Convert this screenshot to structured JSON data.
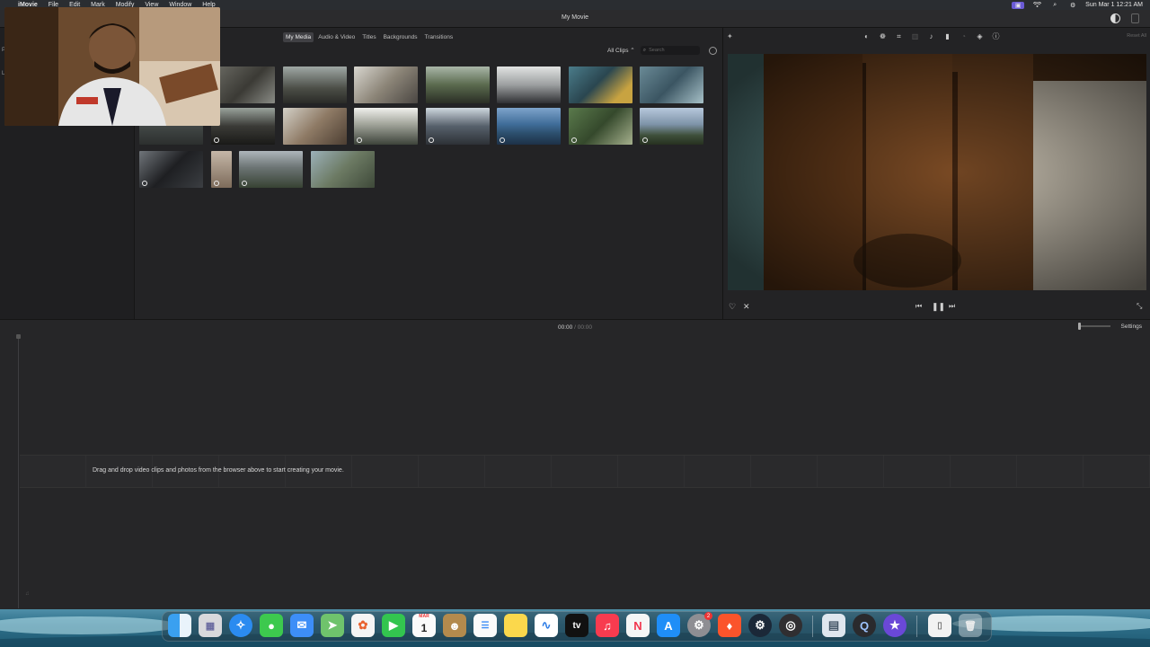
{
  "menubar": {
    "app_name": "iMovie",
    "items": [
      "File",
      "Edit",
      "Mark",
      "Modify",
      "View",
      "Window",
      "Help"
    ],
    "clock": "Sun Mar 1  12:21 AM"
  },
  "window": {
    "title": "My Movie"
  },
  "browser": {
    "tabs": [
      "My Media",
      "Audio & Video",
      "Titles",
      "Backgrounds",
      "Transitions"
    ],
    "active_tab": "My Media",
    "filter": "All Clips",
    "search_placeholder": "Search"
  },
  "viewer": {
    "reset_all": "Reset All"
  },
  "timeline": {
    "current_time": "00:00",
    "separator": "/",
    "duration": "00:00",
    "settings_label": "Settings",
    "drop_hint": "Drag and drop video clips and photos from the browser above to start creating your movie."
  },
  "dock": {
    "calendar_month": "MAR",
    "calendar_day": "1",
    "system_settings_badge": "2",
    "tv_label": "tv",
    "items": [
      "finder-icon",
      "launchpad-icon",
      "safari-icon",
      "messages-icon",
      "mail-icon",
      "maps-icon",
      "photos-icon",
      "facetime-icon",
      "calendar-icon",
      "contacts-icon",
      "reminders-icon",
      "notes-icon",
      "freeform-icon",
      "apple-tv-icon",
      "music-icon",
      "news-icon",
      "app-store-icon",
      "system-settings-icon",
      "brave-icon",
      "steam-icon",
      "obs-icon",
      "preview-icon",
      "quicktime-icon",
      "imovie-icon",
      "document-icon",
      "trash-icon"
    ]
  },
  "colors": {
    "accent": "#6b5bd6",
    "panel": "#232325",
    "timeline": "#262628"
  }
}
